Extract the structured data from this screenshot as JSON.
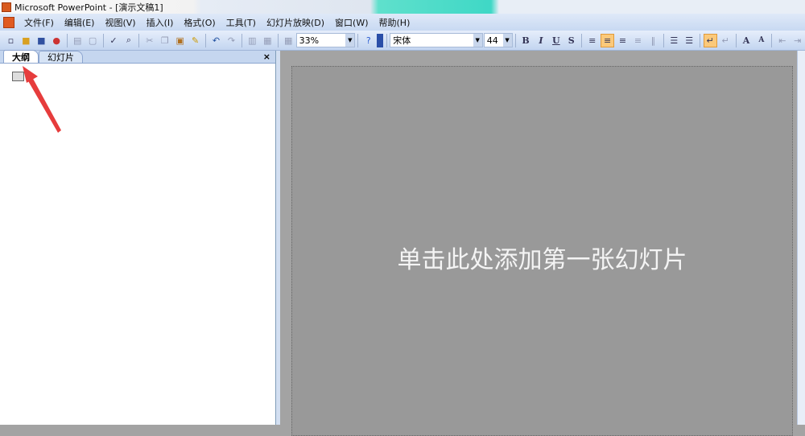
{
  "title": "Microsoft PowerPoint - [演示文稿1]",
  "menu": [
    "文件(F)",
    "编辑(E)",
    "视图(V)",
    "插入(I)",
    "格式(O)",
    "工具(T)",
    "幻灯片放映(D)",
    "窗口(W)",
    "帮助(H)"
  ],
  "toolbar": {
    "zoom": "33%",
    "font": "宋体",
    "font_size": "44",
    "bold": "B",
    "italic": "I",
    "underline": "U",
    "shadow": "S"
  },
  "tabs": {
    "outline": "大纲",
    "slides": "幻灯片",
    "close": "×"
  },
  "slide": {
    "placeholder": "单击此处添加第一张幻灯片"
  }
}
